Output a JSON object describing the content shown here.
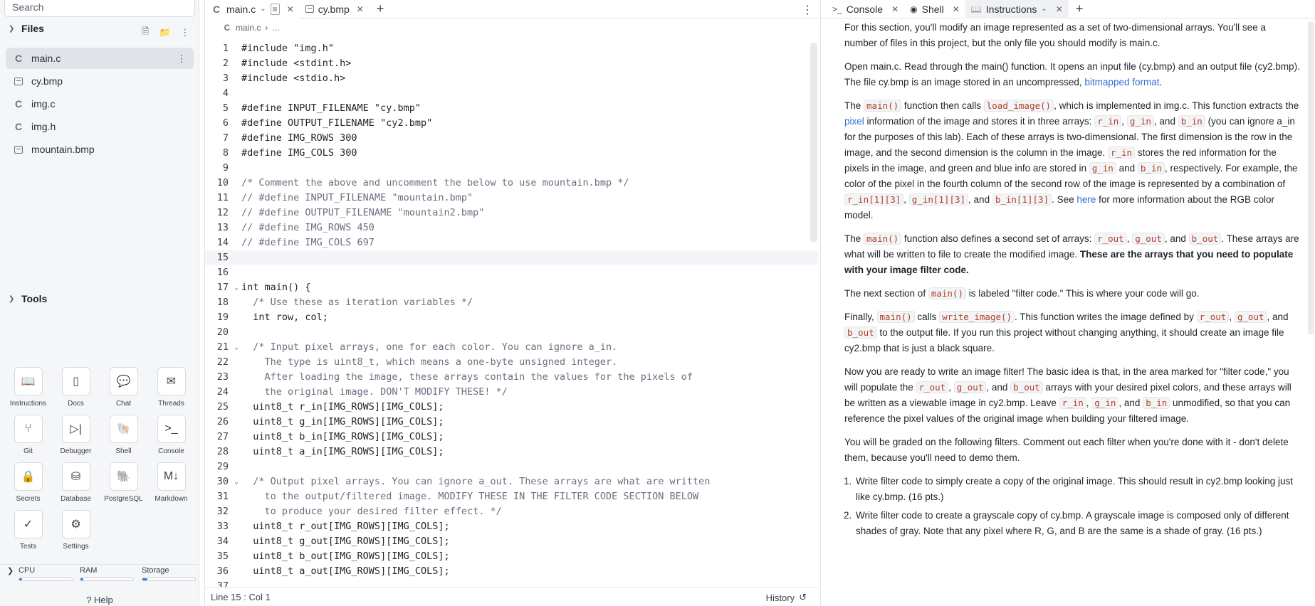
{
  "sidebar": {
    "search_placeholder": "Search",
    "files_title": "Files",
    "files": [
      {
        "name": "main.c",
        "type": "c"
      },
      {
        "name": "cy.bmp",
        "type": "image"
      },
      {
        "name": "img.c",
        "type": "c"
      },
      {
        "name": "img.h",
        "type": "c"
      },
      {
        "name": "mountain.bmp",
        "type": "image"
      }
    ],
    "tools_title": "Tools",
    "tools": [
      {
        "label": "Instructions",
        "icon": "book-icon",
        "glyph": "📖"
      },
      {
        "label": "Docs",
        "icon": "docs-icon",
        "glyph": "▯"
      },
      {
        "label": "Chat",
        "icon": "chat-icon",
        "glyph": "💬"
      },
      {
        "label": "Threads",
        "icon": "threads-icon",
        "glyph": "✉"
      },
      {
        "label": "Git",
        "icon": "git-icon",
        "glyph": "⑂"
      },
      {
        "label": "Debugger",
        "icon": "debugger-icon",
        "glyph": "▷|"
      },
      {
        "label": "Shell",
        "icon": "shell-icon",
        "glyph": "🐚"
      },
      {
        "label": "Console",
        "icon": "console-icon",
        "glyph": ">_"
      },
      {
        "label": "Secrets",
        "icon": "lock-icon",
        "glyph": "🔒"
      },
      {
        "label": "Database",
        "icon": "database-icon",
        "glyph": "⛁"
      },
      {
        "label": "PostgreSQL",
        "icon": "postgresql-icon",
        "glyph": "🐘"
      },
      {
        "label": "Markdown",
        "icon": "markdown-icon",
        "glyph": "M↓"
      },
      {
        "label": "Tests",
        "icon": "check-icon",
        "glyph": "✓"
      },
      {
        "label": "Settings",
        "icon": "gear-icon",
        "glyph": "⚙"
      }
    ],
    "resources": {
      "cpu": "CPU",
      "ram": "RAM",
      "storage": "Storage",
      "cpu_level": 0.05,
      "ram_level": 0.05,
      "storage_level": 0.1
    },
    "help_label": "Help"
  },
  "editor": {
    "tabs": [
      {
        "label": "main.c",
        "icon": "c-file-icon"
      },
      {
        "label": "cy.bmp",
        "icon": "image-icon"
      }
    ],
    "breadcrumb": {
      "file": "main.c",
      "rest": "..."
    },
    "current_line": 15,
    "lines": [
      {
        "n": 1,
        "text": "#include \"img.h\"",
        "kind": "pp"
      },
      {
        "n": 2,
        "text": "#include <stdint.h>",
        "kind": "pp"
      },
      {
        "n": 3,
        "text": "#include <stdio.h>",
        "kind": "pp"
      },
      {
        "n": 4,
        "text": "",
        "kind": "code"
      },
      {
        "n": 5,
        "text": "#define INPUT_FILENAME \"cy.bmp\"",
        "kind": "pp"
      },
      {
        "n": 6,
        "text": "#define OUTPUT_FILENAME \"cy2.bmp\"",
        "kind": "pp"
      },
      {
        "n": 7,
        "text": "#define IMG_ROWS 300",
        "kind": "pp"
      },
      {
        "n": 8,
        "text": "#define IMG_COLS 300",
        "kind": "pp"
      },
      {
        "n": 9,
        "text": "",
        "kind": "code"
      },
      {
        "n": 10,
        "text": "/* Comment the above and uncomment the below to use mountain.bmp */",
        "kind": "comment"
      },
      {
        "n": 11,
        "text": "// #define INPUT_FILENAME \"mountain.bmp\"",
        "kind": "comment"
      },
      {
        "n": 12,
        "text": "// #define OUTPUT_FILENAME \"mountain2.bmp\"",
        "kind": "comment"
      },
      {
        "n": 13,
        "text": "// #define IMG_ROWS 450",
        "kind": "comment"
      },
      {
        "n": 14,
        "text": "// #define IMG_COLS 697",
        "kind": "comment"
      },
      {
        "n": 15,
        "text": "",
        "kind": "code"
      },
      {
        "n": 16,
        "text": "",
        "kind": "code"
      },
      {
        "n": 17,
        "text": "int main() {",
        "kind": "code",
        "fold": true
      },
      {
        "n": 18,
        "text": "  /* Use these as iteration variables */",
        "kind": "comment"
      },
      {
        "n": 19,
        "text": "  int row, col;",
        "kind": "code"
      },
      {
        "n": 20,
        "text": "",
        "kind": "code"
      },
      {
        "n": 21,
        "text": "  /* Input pixel arrays, one for each color. You can ignore a_in.",
        "kind": "comment",
        "fold": true
      },
      {
        "n": 22,
        "text": "    The type is uint8_t, which means a one-byte unsigned integer.",
        "kind": "comment"
      },
      {
        "n": 23,
        "text": "    After loading the image, these arrays contain the values for the pixels of",
        "kind": "comment"
      },
      {
        "n": 24,
        "text": "    the original image. DON'T MODIFY THESE! */",
        "kind": "comment"
      },
      {
        "n": 25,
        "text": "  uint8_t r_in[IMG_ROWS][IMG_COLS];",
        "kind": "code"
      },
      {
        "n": 26,
        "text": "  uint8_t g_in[IMG_ROWS][IMG_COLS];",
        "kind": "code"
      },
      {
        "n": 27,
        "text": "  uint8_t b_in[IMG_ROWS][IMG_COLS];",
        "kind": "code"
      },
      {
        "n": 28,
        "text": "  uint8_t a_in[IMG_ROWS][IMG_COLS];",
        "kind": "code"
      },
      {
        "n": 29,
        "text": "",
        "kind": "code"
      },
      {
        "n": 30,
        "text": "  /* Output pixel arrays. You can ignore a_out. These arrays are what are written",
        "kind": "comment",
        "fold": true
      },
      {
        "n": 31,
        "text": "    to the output/filtered image. MODIFY THESE IN THE FILTER CODE SECTION BELOW",
        "kind": "comment"
      },
      {
        "n": 32,
        "text": "    to produce your desired filter effect. */",
        "kind": "comment"
      },
      {
        "n": 33,
        "text": "  uint8_t r_out[IMG_ROWS][IMG_COLS];",
        "kind": "code"
      },
      {
        "n": 34,
        "text": "  uint8_t g_out[IMG_ROWS][IMG_COLS];",
        "kind": "code"
      },
      {
        "n": 35,
        "text": "  uint8_t b_out[IMG_ROWS][IMG_COLS];",
        "kind": "code"
      },
      {
        "n": 36,
        "text": "  uint8_t a_out[IMG_ROWS][IMG_COLS];",
        "kind": "code"
      },
      {
        "n": 37,
        "text": "",
        "kind": "code"
      }
    ],
    "status": "Line 15 : Col 1",
    "history_label": "History"
  },
  "right_panel": {
    "tabs": [
      {
        "label": "Console",
        "icon": "console-icon"
      },
      {
        "label": "Shell",
        "icon": "shell-icon"
      },
      {
        "label": "Instructions",
        "icon": "book-icon"
      }
    ],
    "active_tab": "Instructions"
  },
  "colors": {
    "accent": "#2f6fd0",
    "inline_code": "#b0402a",
    "comment": "#6b7080"
  }
}
